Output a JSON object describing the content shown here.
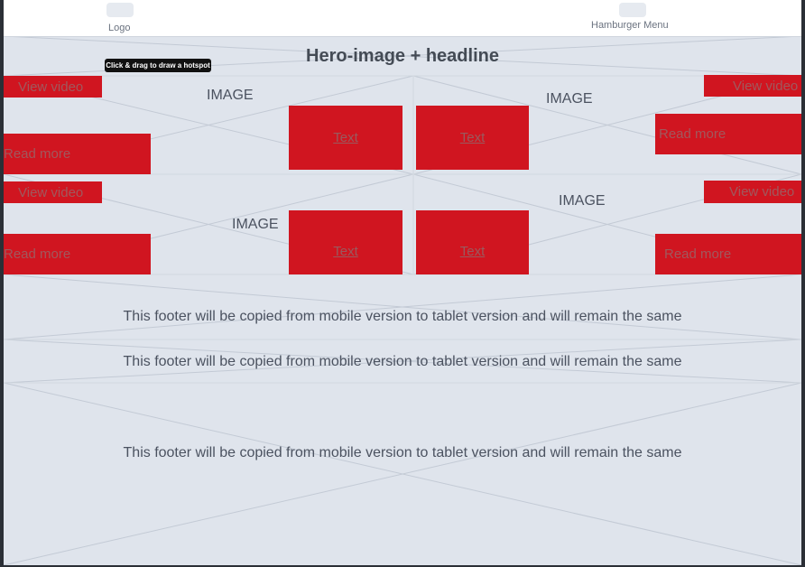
{
  "header": {
    "logo_label": "Logo",
    "menu_label": "Hamburger Menu"
  },
  "hero": {
    "headline": "Hero-image + headline"
  },
  "tooltip": "Click & drag to draw a hotspot",
  "section1": {
    "image_left": "IMAGE",
    "image_right": "IMAGE",
    "view_video_left": "View video",
    "view_video_right": "View video",
    "read_more_left": "Read more",
    "read_more_right": "Read more",
    "text_a": "Text",
    "text_b": "Text"
  },
  "section2": {
    "image_left": "IMAGE",
    "image_right": "IMAGE",
    "view_video_left": "View video",
    "view_video_right": "View video",
    "read_more_left": "Read more",
    "read_more_right": "Read more",
    "text_a": "Text",
    "text_b": "Text"
  },
  "footers": [
    "This footer will be copied from mobile version to tablet version and will remain the same",
    "This footer will be copied from mobile version to tablet version and will remain the same",
    "This footer will be copied from mobile version to tablet version and will remain the same"
  ],
  "colors": {
    "accent_red": "#d01520",
    "canvas": "#dfe4ec",
    "wire": "#c3cad5"
  }
}
